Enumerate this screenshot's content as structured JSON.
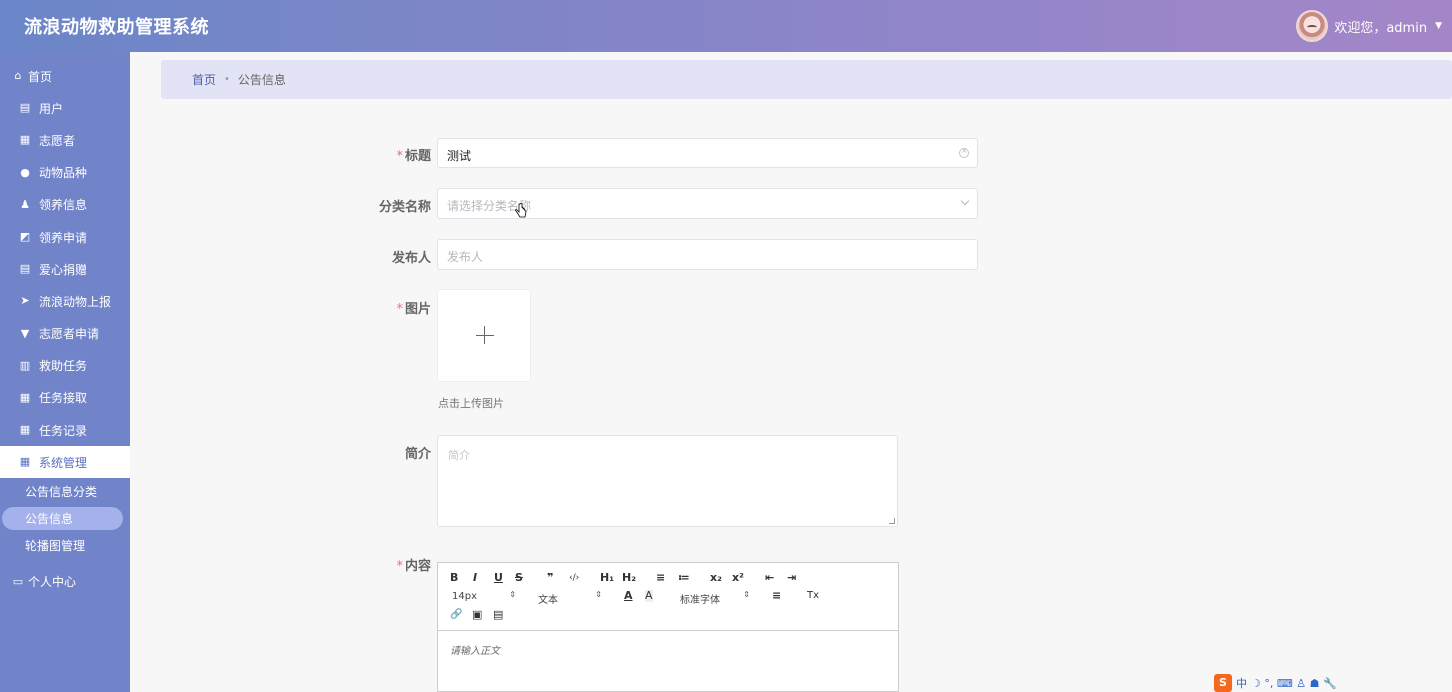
{
  "app": {
    "title": "流浪动物救助管理系统",
    "welcome": "欢迎您，admin"
  },
  "sidebar": {
    "home": "首页",
    "items": [
      {
        "label": "用户",
        "icon": "clipboard-icon"
      },
      {
        "label": "志愿者",
        "icon": "grid-icon"
      },
      {
        "label": "动物品种",
        "icon": "balloon-icon"
      },
      {
        "label": "领养信息",
        "icon": "person-icon"
      },
      {
        "label": "领养申请",
        "icon": "chart-icon"
      },
      {
        "label": "爱心捐赠",
        "icon": "clipboard-icon"
      },
      {
        "label": "流浪动物上报",
        "icon": "send-icon"
      },
      {
        "label": "志愿者申请",
        "icon": "thumbs-down-icon"
      },
      {
        "label": "救助任务",
        "icon": "bars-icon"
      },
      {
        "label": "任务接取",
        "icon": "grid-icon"
      },
      {
        "label": "任务记录",
        "icon": "grid-icon"
      },
      {
        "label": "系统管理",
        "icon": "grid-icon"
      }
    ],
    "sub_items": [
      "公告信息分类",
      "公告信息",
      "轮播图管理"
    ],
    "center": "个人中心"
  },
  "breadcrumb": {
    "home": "首页",
    "separator": "•",
    "current": "公告信息"
  },
  "form": {
    "title_label": "标题",
    "title_value": "测试",
    "category_label": "分类名称",
    "category_placeholder": "请选择分类名称",
    "publisher_label": "发布人",
    "publisher_placeholder": "发布人",
    "image_label": "图片",
    "upload_tip": "点击上传图片",
    "intro_label": "简介",
    "intro_placeholder": "简介",
    "content_label": "内容",
    "required_mark": "*"
  },
  "editor": {
    "font_size": "14px",
    "header_type": "文本",
    "font_family": "标准字体",
    "placeholder": "请输入正文",
    "buttons": {
      "bold": "B",
      "italic": "I",
      "underline": "U",
      "strike": "S",
      "quote": "❞",
      "code": "‹/›",
      "h1": "H₁",
      "h2": "H₂",
      "ordered_list": "≡",
      "bullet_list": "≔",
      "subscript": "x₂",
      "superscript": "x²",
      "outdent": "⇤",
      "indent": "⇥",
      "color": "A",
      "background": "A",
      "align": "≡",
      "clean": "Tx",
      "link": "🔗",
      "image": "▣",
      "video": "▤"
    }
  },
  "ime": {
    "logo": "S",
    "lang": "中",
    "extra": "☽ °, ⌨ ♙ ☗ 🔧"
  }
}
